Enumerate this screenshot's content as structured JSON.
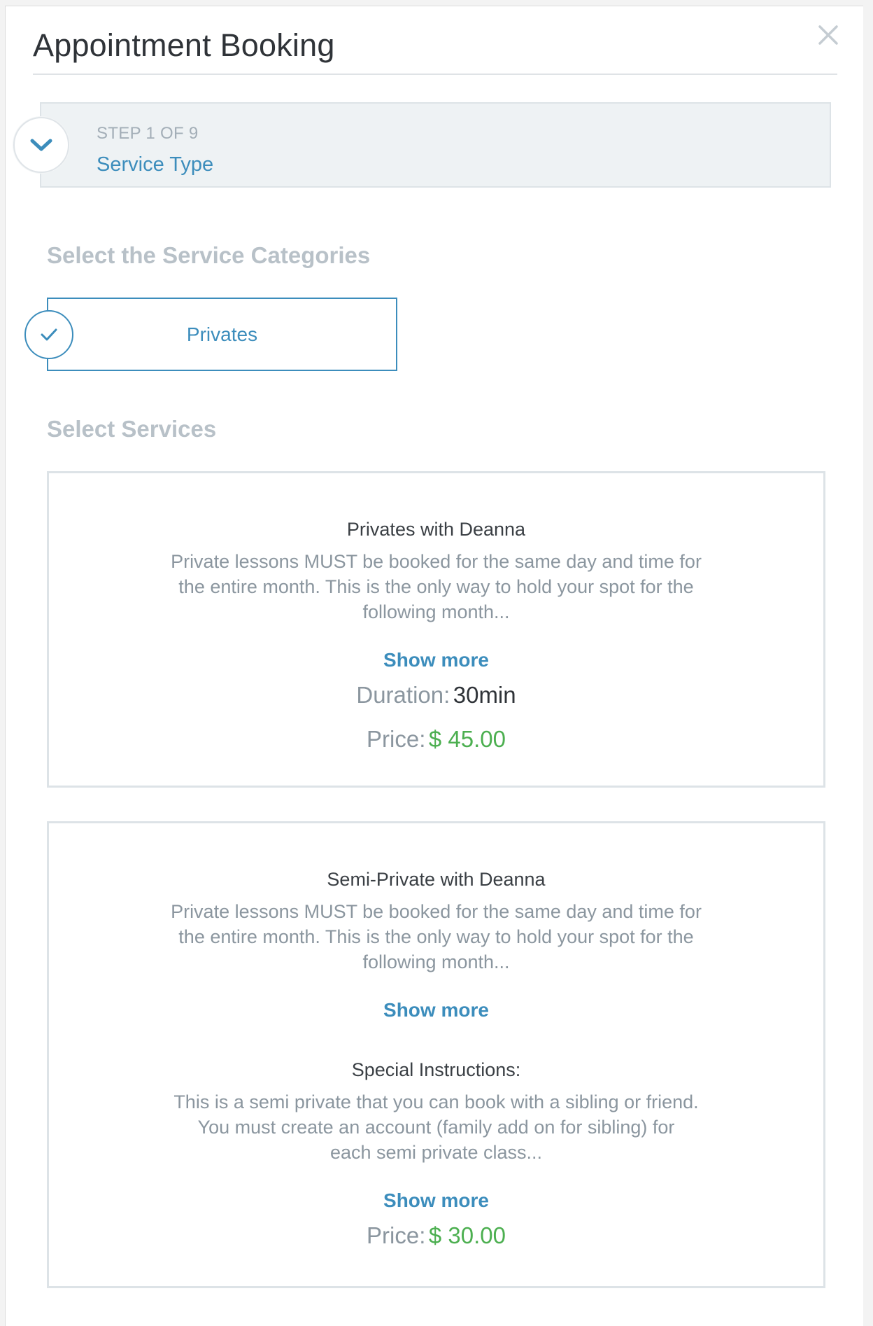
{
  "modal": {
    "title": "Appointment Booking"
  },
  "step": {
    "count_label": "STEP 1 OF 9",
    "name": "Service Type"
  },
  "categories_section": {
    "heading": "Select the Service Categories",
    "items": [
      {
        "label": "Privates",
        "selected": true
      }
    ]
  },
  "services_section": {
    "heading": "Select Services",
    "services": [
      {
        "name": "Privates with Deanna",
        "description_lines": [
          "Private lessons MUST be booked for the same day and time for",
          "the entire month.   This is the only way to hold your spot for the",
          "following month..."
        ],
        "show_more": "Show more",
        "duration_label": "Duration:",
        "duration_value": "30min",
        "price_label": "Price:",
        "price_value": "$ 45.00"
      },
      {
        "name": "Semi-Private with Deanna",
        "description_lines": [
          "Private lessons MUST be booked for the same day and time for",
          "the entire month.   This is the only way to hold your spot for the",
          "following month..."
        ],
        "show_more": "Show more",
        "special_label": "Special Instructions:",
        "special_lines": [
          "This is a semi private that you can book with a sibling or friend.",
          "You must create an account (family add on for sibling)  for",
          "each semi private class..."
        ],
        "special_show_more": "Show more",
        "price_label": "Price:",
        "price_value": "$ 30.00"
      }
    ]
  },
  "colors": {
    "accent": "#3c8dbc",
    "price": "#4caf50",
    "muted": "#8b969f",
    "border": "#dde3e7"
  },
  "icons": {
    "close": "close-icon",
    "toggle": "chevron-down-icon",
    "selected": "check-icon"
  }
}
